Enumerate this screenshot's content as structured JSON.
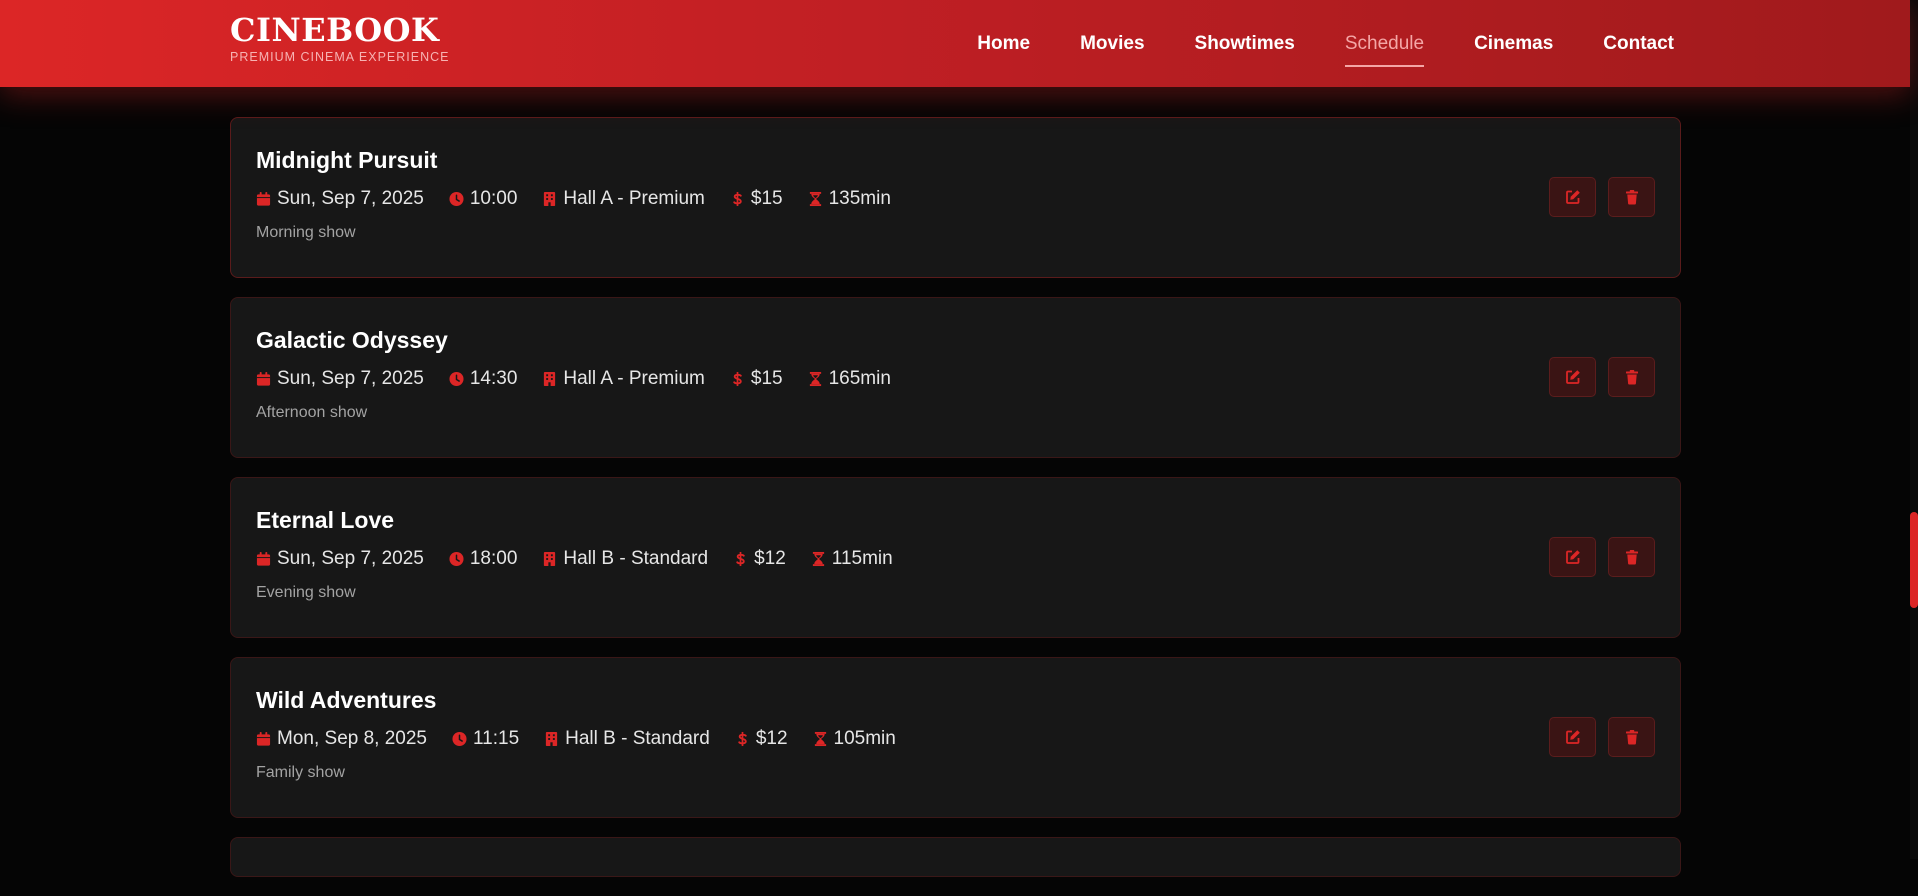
{
  "brand": {
    "name": "CINEBOOK",
    "tagline": "PREMIUM CINEMA EXPERIENCE"
  },
  "nav": [
    {
      "label": "Home",
      "active": false
    },
    {
      "label": "Movies",
      "active": false
    },
    {
      "label": "Showtimes",
      "active": false
    },
    {
      "label": "Schedule",
      "active": true
    },
    {
      "label": "Cinemas",
      "active": false
    },
    {
      "label": "Contact",
      "active": false
    }
  ],
  "colors": {
    "accent": "#dc2626",
    "card_bg": "#171717",
    "page_bg": "#050505"
  },
  "icons": {
    "date": "calendar-icon",
    "time": "clock-icon",
    "hall": "building-icon",
    "price": "dollar-icon",
    "duration": "hourglass-icon",
    "edit": "edit-icon",
    "delete": "trash-icon"
  },
  "showtimes": [
    {
      "title": "Midnight Pursuit",
      "date": "Sun, Sep 7, 2025",
      "time": "10:00",
      "hall": "Hall A - Premium",
      "price": "$15",
      "duration": "135min",
      "note": "Morning show"
    },
    {
      "title": "Galactic Odyssey",
      "date": "Sun, Sep 7, 2025",
      "time": "14:30",
      "hall": "Hall A - Premium",
      "price": "$15",
      "duration": "165min",
      "note": "Afternoon show"
    },
    {
      "title": "Eternal Love",
      "date": "Sun, Sep 7, 2025",
      "time": "18:00",
      "hall": "Hall B - Standard",
      "price": "$12",
      "duration": "115min",
      "note": "Evening show"
    },
    {
      "title": "Wild Adventures",
      "date": "Mon, Sep 8, 2025",
      "time": "11:15",
      "hall": "Hall B - Standard",
      "price": "$12",
      "duration": "105min",
      "note": "Family show"
    }
  ]
}
